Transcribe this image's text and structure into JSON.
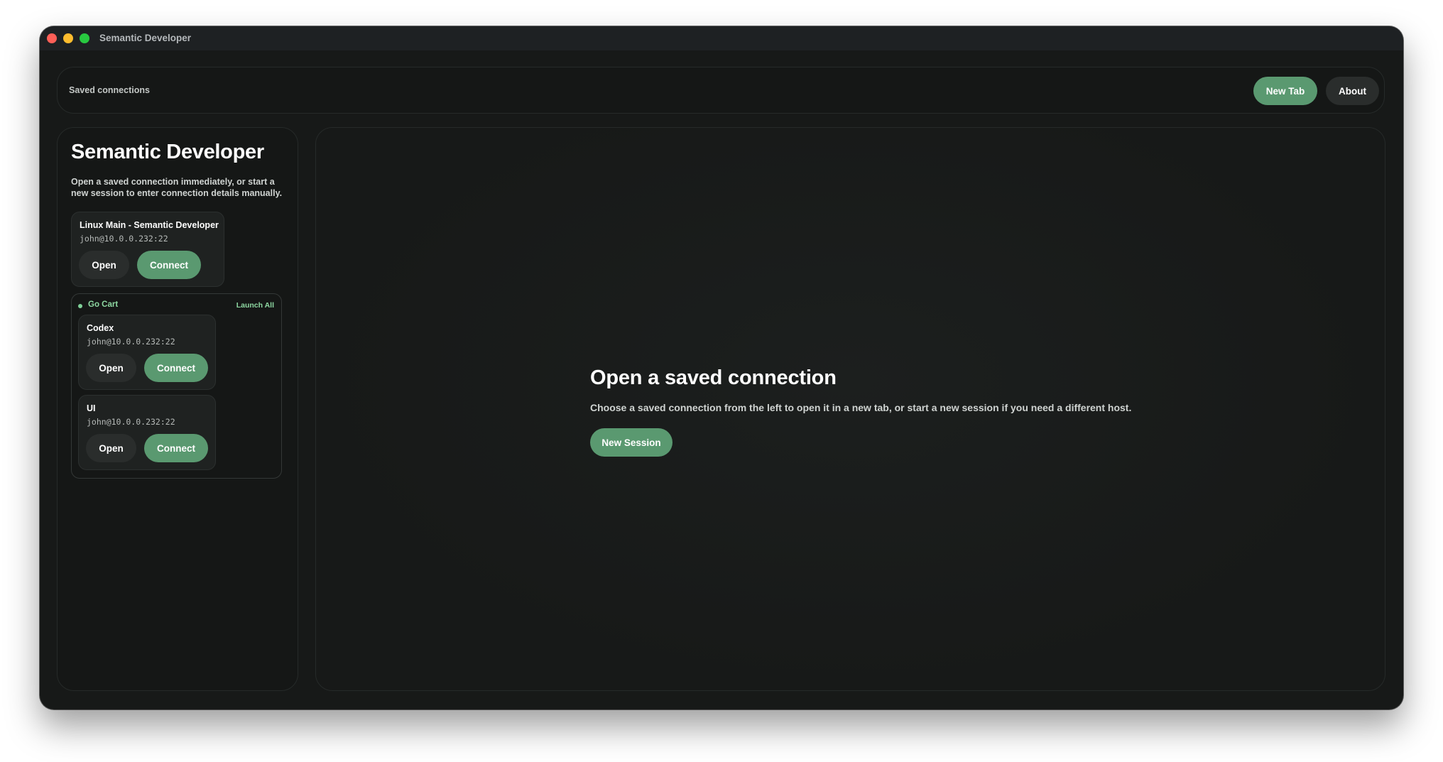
{
  "window": {
    "title": "Semantic Developer"
  },
  "topbar": {
    "label": "Saved connections",
    "new_tab_label": "New Tab",
    "about_label": "About"
  },
  "sidebar": {
    "title": "Semantic Developer",
    "description": "Open a saved connection immediately, or start a new session to enter connection details manually.",
    "connections": [
      {
        "name": "Linux Main - Semantic Developer",
        "host": "john@10.0.0.232:22",
        "open_label": "Open",
        "connect_label": "Connect"
      }
    ],
    "groups": [
      {
        "name": "Go Cart",
        "launch_label": "Launch All",
        "connections": [
          {
            "name": "Codex",
            "host": "john@10.0.0.232:22",
            "open_label": "Open",
            "connect_label": "Connect"
          },
          {
            "name": "UI",
            "host": "john@10.0.0.232:22",
            "open_label": "Open",
            "connect_label": "Connect"
          }
        ]
      }
    ]
  },
  "main": {
    "title": "Open a saved connection",
    "description": "Choose a saved connection from the left to open it in a new tab, or start a new session if you need a different host.",
    "new_session_label": "New Session"
  },
  "colors": {
    "accent": "#5a9970",
    "group_accent": "#8ed8a2",
    "background": "#171918"
  }
}
